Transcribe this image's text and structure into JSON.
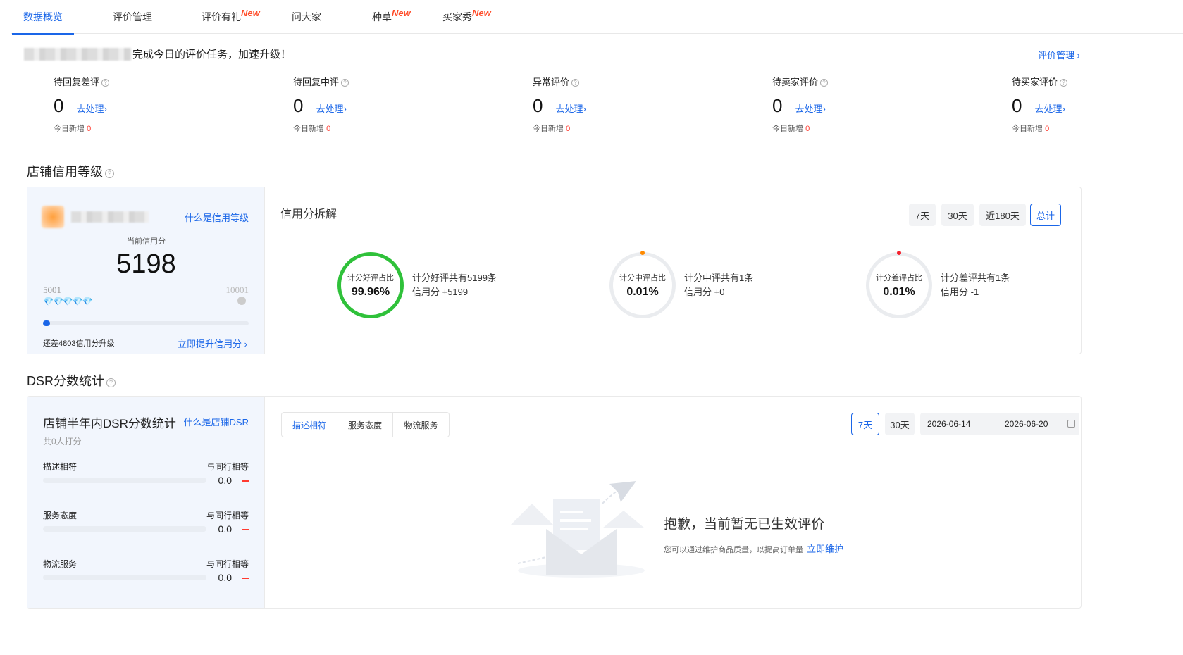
{
  "tabs": [
    {
      "label": "数据概览",
      "new": ""
    },
    {
      "label": "评价管理",
      "new": ""
    },
    {
      "label": "评价有礼",
      "new": "New"
    },
    {
      "label": "问大家",
      "new": ""
    },
    {
      "label": "种草",
      "new": "New"
    },
    {
      "label": "买家秀",
      "new": "New"
    }
  ],
  "notice": {
    "text": "完成今日的评价任务，加速升级！",
    "link": "评价管理 ›"
  },
  "stats": [
    {
      "label": "待回复差评",
      "value": "0",
      "action": "去处理›",
      "today_label": "今日新增",
      "today_value": "0"
    },
    {
      "label": "待回复中评",
      "value": "0",
      "action": "去处理›",
      "today_label": "今日新增",
      "today_value": "0"
    },
    {
      "label": "异常评价",
      "value": "0",
      "action": "去处理›",
      "today_label": "今日新增",
      "today_value": "0"
    },
    {
      "label": "待卖家评价",
      "value": "0",
      "action": "去处理›",
      "today_label": "今日新增",
      "today_value": "0"
    },
    {
      "label": "待买家评价",
      "value": "0",
      "action": "去处理›",
      "today_label": "今日新增",
      "today_value": "0"
    }
  ],
  "credit": {
    "section_title": "店铺信用等级",
    "what_link": "什么是信用等级",
    "current_label": "当前信用分",
    "current_value": "5198",
    "range_min": "5001",
    "range_max": "10001",
    "progress": 0.02,
    "remaining": "还差4803信用分升级",
    "improve_link": "立即提升信用分 ›",
    "breakdown_title": "信用分拆解",
    "periods": [
      "7天",
      "30天",
      "近180天",
      "总计"
    ],
    "active_period": "总计",
    "rings": [
      {
        "label": "计分好评占比",
        "value": "99.96%",
        "desc1": "计分好评共有5199条",
        "desc2": "信用分 +5199",
        "color": "#2fc13a",
        "fraction": 0.9996
      },
      {
        "label": "计分中评占比",
        "value": "0.01%",
        "desc1": "计分中评共有1条",
        "desc2": "信用分 +0",
        "color": "#ff8a00",
        "fraction": 0.0001
      },
      {
        "label": "计分差评占比",
        "value": "0.01%",
        "desc1": "计分差评共有1条",
        "desc2": "信用分 -1",
        "color": "#f5222d",
        "fraction": 0.0001
      }
    ]
  },
  "dsr": {
    "section_title": "DSR分数统计",
    "card_title": "店铺半年内DSR分数统计",
    "what_link": "什么是店铺DSR",
    "raters": "共0人打分",
    "rows": [
      {
        "label": "描述相符",
        "compare": "与同行相等",
        "value": "0.0"
      },
      {
        "label": "服务态度",
        "compare": "与同行相等",
        "value": "0.0"
      },
      {
        "label": "物流服务",
        "compare": "与同行相等",
        "value": "0.0"
      }
    ],
    "segments": [
      "描述相符",
      "服务态度",
      "物流服务"
    ],
    "active_segment": "描述相符",
    "periods": [
      "7天",
      "30天"
    ],
    "active_period": "7天",
    "date_start": "2026-06-14",
    "date_end": "2026-06-20",
    "empty_title": "抱歉，当前暂无已生效评价",
    "empty_desc": "您可以通过维护商品质量，以提高订单量",
    "empty_link": "立即维护"
  }
}
